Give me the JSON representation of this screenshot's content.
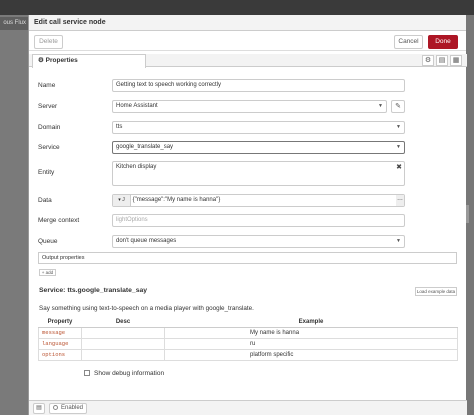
{
  "background": {
    "left_tab_label": "ous Flux"
  },
  "dialog": {
    "title": "Edit call service node",
    "delete_label": "Delete",
    "cancel_label": "Cancel",
    "done_label": "Done",
    "accent_color": "#ad1625"
  },
  "tabs": {
    "properties_label": "Properties",
    "icons": [
      "gear-icon",
      "document-icon",
      "layout-icon"
    ]
  },
  "form": {
    "name_label": "Name",
    "name_value": "Getting text to speech working correctly",
    "server_label": "Server",
    "server_value": "Home Assistant",
    "domain_label": "Domain",
    "domain_value": "tts",
    "service_label": "Service",
    "service_value": "google_translate_say",
    "entity_label": "Entity",
    "entity_value": "Kitchen display",
    "data_label": "Data",
    "data_value": "{\"message\":\"My name is hanna\"}",
    "merge_label": "Merge context",
    "merge_placeholder": "lightOptions",
    "queue_label": "Queue",
    "queue_value": "don't queue messages",
    "output_label": "Output properties",
    "add_label": "+ add"
  },
  "service": {
    "title": "Service: tts.google_translate_say",
    "load_label": "Load example data",
    "description": "Say something using text-to-speech on a media player with google_translate.",
    "columns": [
      "Property",
      "Desc",
      "Example"
    ],
    "rows": [
      {
        "property": "message",
        "desc": "",
        "example": "My name is hanna"
      },
      {
        "property": "language",
        "desc": "",
        "example": "ru"
      },
      {
        "property": "options",
        "desc": "",
        "example": "platform specific"
      }
    ]
  },
  "debug_label": "Show debug information",
  "footer": {
    "enabled_label": "Enabled"
  }
}
